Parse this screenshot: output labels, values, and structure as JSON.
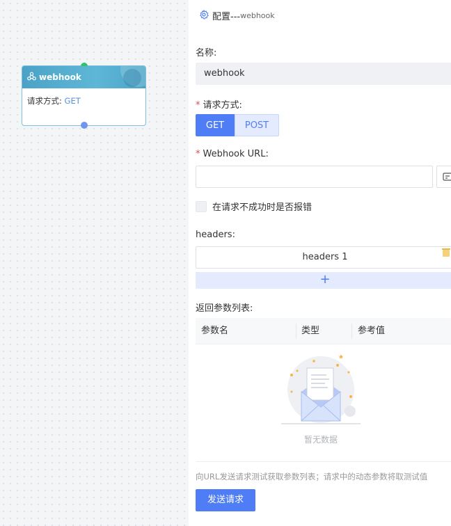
{
  "canvas": {
    "node": {
      "title": "webhook",
      "method_label": "请求方式:",
      "method_value": "GET"
    }
  },
  "panel": {
    "title": "配置---",
    "title_sub": "webhook",
    "name_label": "名称:",
    "name_value": "webhook",
    "method_label": "请求方式:",
    "method_options": [
      "GET",
      "POST"
    ],
    "method_selected": "GET",
    "url_label": "Webhook URL:",
    "url_value": "",
    "error_checkbox_label": "在请求不成功时是否报错",
    "error_checkbox_checked": false,
    "headers_label": "headers:",
    "headers_items": [
      "headers 1"
    ],
    "add_symbol": "+",
    "return_params_label": "返回参数列表:",
    "table_columns": [
      "参数名",
      "类型",
      "参考值"
    ],
    "table_empty_text": "暂无数据",
    "hint_text": "向URL发送请求测试获取参数列表；请求中的动态参数将取测试值",
    "send_button": "发送请求"
  },
  "colors": {
    "primary": "#4f7df5",
    "node_header": "#4aa3c7",
    "port_in": "#2ec46b",
    "port_out": "#6e95f0",
    "required": "#e24b4b"
  },
  "icons": {
    "node_icon": "webhook-icon",
    "panel_icon": "gear-icon",
    "url_button_icon": "edit-icon",
    "delete_icon": "trash-icon",
    "empty_icon": "empty-envelope-icon"
  }
}
